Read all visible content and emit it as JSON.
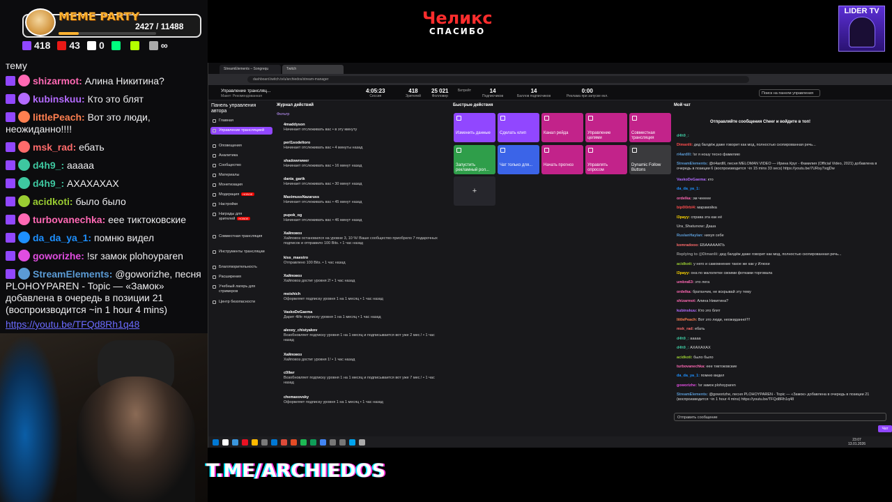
{
  "overlay": {
    "meme_party": {
      "title": "MEME PARTY",
      "count": "2427 / 11488",
      "progress": 0.21
    },
    "stats": [
      {
        "icon": "twitch-icon",
        "value": "418"
      },
      {
        "icon": "live-icon",
        "value": "43"
      },
      {
        "icon": "w-icon",
        "value": "0"
      },
      {
        "icon": "d-icon",
        "value": ""
      },
      {
        "icon": "n-icon",
        "value": ""
      },
      {
        "icon": "infinity-icon",
        "value": "∞"
      }
    ],
    "brand": {
      "name": "Челикс",
      "sub": "СПАСИБО"
    },
    "lider": "LIDER TV",
    "telegram": "T.ME/ARCHIEDOS"
  },
  "left_chat": [
    {
      "nick": "",
      "msg": "тему",
      "color": "#ffffff"
    },
    {
      "nick": "shizarmot:",
      "msg": "Алина Никитина?",
      "color": "#ff69b4"
    },
    {
      "nick": "kubinskuu:",
      "msg": "Кто это блят",
      "color": "#b46bff"
    },
    {
      "nick": "littlePeach:",
      "msg": "Вот это люди, неожиданно!!!!",
      "color": "#ff7f50"
    },
    {
      "nick": "msk_rad:",
      "msg": "ебать",
      "color": "#ff6b6b"
    },
    {
      "nick": "d4h9_:",
      "msg": "ааааа",
      "color": "#3ec7a0"
    },
    {
      "nick": "d4h9_:",
      "msg": "АХАХАХАХ",
      "color": "#3ec7a0"
    },
    {
      "nick": "acidkoti:",
      "msg": "было было",
      "color": "#9acd32"
    },
    {
      "nick": "turbovanechka:",
      "msg": "еее тиктоковские",
      "color": "#ff69b4"
    },
    {
      "nick": "da_da_ya_1:",
      "msg": "помню видел",
      "color": "#1e90ff"
    },
    {
      "nick": "goworizhe:",
      "msg": "!sr замок plohoyparen",
      "color": "#e04de0"
    },
    {
      "nick": "StreamElements:",
      "msg": "@goworizhe, песня PLOHOYPAREN - Topic — «Замок» добавлена в очередь в позиции 21 (воспроизводится ~in 1 hour 4 mins)",
      "color": "#5b9bd5"
    }
  ],
  "left_link": "https://youtu.be/TFQd8Rh1q48",
  "browser": {
    "tabs": [
      "StreamElements – Songrequ",
      "Twitch"
    ],
    "url": "dashboard.twitch.tv/u/archiedos/stream-manager",
    "title": "Управление трансляц...",
    "subtitle": "Макет: Рекомендованная",
    "metrics": [
      {
        "v": "4:05:23",
        "l": "Сессия"
      },
      {
        "v": "418",
        "l": "Зрителей"
      },
      {
        "v": "25 021",
        "l": "Фолловер"
      },
      {
        "v": "",
        "l": "Битрейт"
      },
      {
        "v": "14",
        "l": "Подписчиков"
      },
      {
        "v": "14",
        "l": "Баллов подписчиков"
      },
      {
        "v": "0:00",
        "l": "Реклама при запуске екл."
      }
    ],
    "search_placeholder": "Поиск на панели управления",
    "sidebar_title": "Панель управления автора",
    "sidebar_items": [
      {
        "label": "Главная",
        "active": false,
        "badge": ""
      },
      {
        "label": "Управление трансляцией",
        "active": true,
        "badge": ""
      },
      {
        "label": "Оповещения",
        "active": false,
        "badge": ""
      },
      {
        "label": "Аналитика",
        "active": false,
        "badge": ""
      },
      {
        "label": "Сообщество",
        "active": false,
        "badge": ""
      },
      {
        "label": "Материалы",
        "active": false,
        "badge": ""
      },
      {
        "label": "Монетизация",
        "active": false,
        "badge": ""
      },
      {
        "label": "Модерация",
        "active": false,
        "badge": "НОВОЕ"
      },
      {
        "label": "Настройки",
        "active": false,
        "badge": ""
      },
      {
        "label": "Награды для зрителей",
        "active": false,
        "badge": "НОВОЕ"
      },
      {
        "label": "Совместная трансляция",
        "active": false,
        "badge": ""
      },
      {
        "label": "Инструменты трансляции",
        "active": false,
        "badge": ""
      },
      {
        "label": "Благотворительность",
        "active": false,
        "badge": ""
      },
      {
        "label": "Расширения",
        "active": false,
        "badge": ""
      },
      {
        "label": "Учебный лагерь для стримеров",
        "active": false,
        "badge": ""
      },
      {
        "label": "Центр безопасности",
        "active": false,
        "badge": ""
      }
    ],
    "feed_header": "Журнал действий",
    "feed_filter": "Фильтр",
    "feed": [
      {
        "name": "4maddyson",
        "text": "Начинает отслеживать вас • в эту минуту"
      },
      {
        "name": "perl1sodeltoro",
        "text": "Начинает отслеживать вас • 4 минуты назад"
      },
      {
        "name": "shadowrwwer",
        "text": "Начинает отслеживать вас • 16 минут назад"
      },
      {
        "name": "dania_garik",
        "text": "Начинает отслеживать вас • 30 минут назад"
      },
      {
        "name": "MaximussNazaruss",
        "text": "Начинает отслеживать вас • 45 минут назад"
      },
      {
        "name": "pupok_og",
        "text": "Начинает отслеживать вас • 46 минут назад"
      },
      {
        "name": "Хайповоз",
        "text": "Хайповоз остановился на уровне 3, 10 %! Ваше сообщество приобрело 7 подарочных подписок и отправило 100 Bits. • 1 час назад"
      },
      {
        "name": "kiss_maestro",
        "text": "Отправлено 100 Bits. • 1 час назад"
      },
      {
        "name": "Хайповоз",
        "text": "Хайповоз достиг уровня 2! • 1 час назад"
      },
      {
        "name": "moishich",
        "text": "Оформляет подписку уровня 1 на 1 месяц • 1 час назад"
      },
      {
        "name": "VaskoDeGaema",
        "text": "Дарит 4life подписку уровня 1 на 1 месяц • 1 час назад"
      },
      {
        "name": "alexey_chistyakov",
        "text": "Возобновляет подписку уровня 1 на 1 месяц и подписывается вот уже 2 мес.! • 1 час назад"
      },
      {
        "name": "Хайповоз",
        "text": "Хайповоз достиг уровня 1! • 1 час назад"
      },
      {
        "name": "c0llwr",
        "text": "Возобновляет подписку уровня 1 на 1 месяц и подписывается вот уже 7 мес.! • 1 час назад"
      },
      {
        "name": "chemaxovsky",
        "text": "Оформляет подписку уровня 1 на 1 месяц • 1 час назад"
      }
    ],
    "quick_header": "Быстрые действия",
    "quick_actions": [
      {
        "label": "Изменить данные",
        "color": "#9147ff"
      },
      {
        "label": "Сделать клип",
        "color": "#9147ff"
      },
      {
        "label": "Канал рейда",
        "color": "#c2238a"
      },
      {
        "label": "Управление целями",
        "color": "#c2238a"
      },
      {
        "label": "Совместная трансляция",
        "color": "#c2238a"
      },
      {
        "label": "Запустить рекламный рол...",
        "color": "#2f9e4a"
      },
      {
        "label": "Чат только для...",
        "color": "#3b64e8"
      },
      {
        "label": "Начать прогноз",
        "color": "#c2238a"
      },
      {
        "label": "Управлять опросом",
        "color": "#c2238a"
      },
      {
        "label": "Dynamic Follow Buttons",
        "color": "#3a3a3d"
      }
    ],
    "add_label": "+",
    "chat_header": "Мой чат",
    "cheer_text": "Отправляйте сообщения Cheer и войдите в топ!",
    "chat": [
      {
        "n": "d4h9_:",
        "m": "",
        "c": "#3ec7a0"
      },
      {
        "n": "Dimanlii:",
        "m": "дед балдёж даже говорит как мод, полностью скопированная речь...",
        "c": "#ff4d4d"
      },
      {
        "n": "ri4ardlll:",
        "m": "!sr я ношу тесно фамилию",
        "c": "#5b9bd5"
      },
      {
        "n": "StreamElements:",
        "m": "@ri4ardlll, песня MELOMAN VIDEO — Ирина Круг - Фамилия (Official Video, 2021) добавлена в очередь в позиции 6 (воспроизводится ~in 15 mins 33 secs) https://youtu.be/7URsy7xqjDw",
        "c": "#5b9bd5"
      },
      {
        "n": "VaskoDeGaema:",
        "m": "кто",
        "c": "#b46bff"
      },
      {
        "n": "da_da_ya_1:",
        "m": "",
        "c": "#1e90ff"
      },
      {
        "n": "ordelka:",
        "m": "эм чеееее",
        "c": "#ff69b4"
      },
      {
        "n": "bip0l0rbl4:",
        "m": "марамойка",
        "c": "#ff4d4d"
      },
      {
        "n": "l3payy:",
        "m": "справа эта как её",
        "c": "#ffd700"
      },
      {
        "n": "Ura_Shatunow:",
        "m": "Даша",
        "c": "#aaaaaa"
      },
      {
        "n": "RuslanHaylan:",
        "m": "нихуя себе",
        "c": "#5b9bd5"
      },
      {
        "n": "komradooo:",
        "m": "ЕБААААААТЬ",
        "c": "#ff6b6b"
      },
      {
        "n": "Replying to @Dimanlii:",
        "m": "дед балдёж даже говорит как мод, полностью скопированная речь...",
        "c": "#999999"
      },
      {
        "n": "acidkoti:",
        "m": "у него и самомнение такое же как у Илюхи",
        "c": "#9acd32"
      },
      {
        "n": "l3payy:",
        "m": "она по малолетке своими фотками торговала",
        "c": "#ffd700"
      },
      {
        "n": "umbra63:",
        "m": "это лега",
        "c": "#ff69b4"
      },
      {
        "n": "ordelka:",
        "m": "братанчик, не вскрывай эту тему",
        "c": "#ff69b4"
      },
      {
        "n": "shizarmot:",
        "m": "Алина Никитина?",
        "c": "#ff69b4"
      },
      {
        "n": "kubinskuu:",
        "m": "Кто это блят",
        "c": "#b46bff"
      },
      {
        "n": "littlePeach:",
        "m": "Вот это люди, неожиданно!!!!",
        "c": "#ff7f50"
      },
      {
        "n": "msk_rad:",
        "m": "ебать",
        "c": "#ff6b6b"
      },
      {
        "n": "d4h9_:",
        "m": "ааааа",
        "c": "#3ec7a0"
      },
      {
        "n": "d4h9_:",
        "m": "АХАХАХАХ",
        "c": "#3ec7a0"
      },
      {
        "n": "acidkoti:",
        "m": "было было",
        "c": "#9acd32"
      },
      {
        "n": "turbovanechka:",
        "m": "еее тиктоковские",
        "c": "#ff69b4"
      },
      {
        "n": "da_da_ya_1:",
        "m": "помню видел",
        "c": "#1e90ff"
      },
      {
        "n": "goworizhe:",
        "m": "!sr замок plohoyparen",
        "c": "#e04de0"
      },
      {
        "n": "StreamElements:",
        "m": "@goworizhe, песня PLOHOYPAREN - Topic — «Замок» добавлена в очередь в позиции 21 (воспроизводится ~in 1 hour 4 mins) https://youtu.be/TFQd8Rh1q48",
        "c": "#5b9bd5"
      }
    ],
    "chat_placeholder": "Отправить сообщение",
    "chat_send": "Чат",
    "clock": {
      "time": "23:07",
      "date": "13.01.2026"
    }
  }
}
